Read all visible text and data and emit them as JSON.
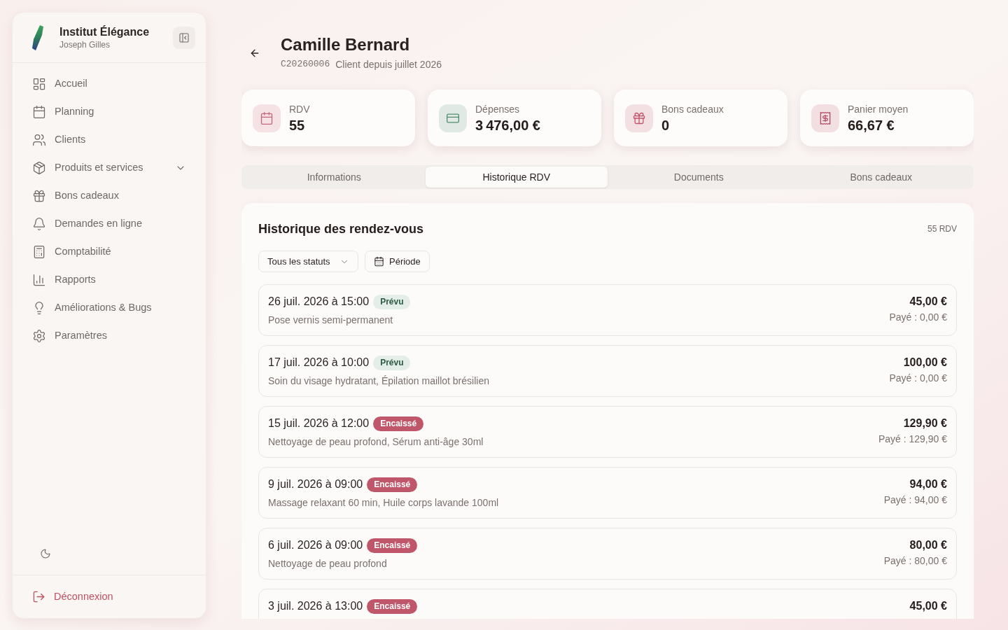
{
  "sidebar": {
    "brand": {
      "name": "Institut Élégance",
      "user": "Joseph Gilles"
    },
    "items": [
      {
        "label": "Accueil",
        "kind": "link",
        "selected": false
      },
      {
        "label": "Planning",
        "kind": "link",
        "selected": false
      },
      {
        "label": "Clients",
        "kind": "link",
        "selected": false
      },
      {
        "label": "Produits et services",
        "kind": "group",
        "selected": false,
        "expanded": false
      },
      {
        "label": "Bons cadeaux",
        "kind": "link",
        "selected": false
      },
      {
        "label": "Demandes en ligne",
        "kind": "link",
        "selected": false
      },
      {
        "label": "Comptabilité",
        "kind": "link",
        "selected": false
      },
      {
        "label": "Rapports",
        "kind": "link",
        "selected": false
      },
      {
        "label": "Améliorations & Bugs",
        "kind": "link",
        "selected": false
      },
      {
        "label": "Paramètres",
        "kind": "link",
        "selected": false
      }
    ],
    "logout": "Déconnexion"
  },
  "client": {
    "name": "Camille Bernard",
    "code": "C20260006",
    "since": "Client depuis juillet 2026"
  },
  "stats": [
    {
      "label": "RDV",
      "value": "55",
      "color": "#c4677a"
    },
    {
      "label": "Dépenses",
      "value": "3 476,00 €",
      "color": "#4f8f6e"
    },
    {
      "label": "Bons cadeaux",
      "value": "0",
      "color": "#c0566a"
    },
    {
      "label": "Panier moyen",
      "value": "66,67 €",
      "color": "#b5526a"
    }
  ],
  "tabs": [
    {
      "label": "Informations",
      "selected": false
    },
    {
      "label": "Historique RDV",
      "selected": true
    },
    {
      "label": "Documents",
      "selected": false
    },
    {
      "label": "Bons cadeaux",
      "selected": false
    }
  ],
  "history": {
    "title": "Historique des rendez-vous",
    "count": "55 RDV",
    "status_filter": {
      "value": "Tous les statuts"
    },
    "period_button": "Période",
    "appointments": [
      {
        "datetime": "26 juil. 2026 à 15:00",
        "status": {
          "label": "Prévu",
          "kind": "planned"
        },
        "services": "Pose vernis semi-permanent",
        "amount": "45,00 €",
        "paid": "Payé : 0,00 €"
      },
      {
        "datetime": "17 juil. 2026 à 10:00",
        "status": {
          "label": "Prévu",
          "kind": "planned"
        },
        "services": "Soin du visage hydratant, Épilation maillot brésilien",
        "amount": "100,00 €",
        "paid": "Payé : 0,00 €"
      },
      {
        "datetime": "15 juil. 2026 à 12:00",
        "status": {
          "label": "Encaissé",
          "kind": "cashed"
        },
        "services": "Nettoyage de peau profond, Sérum anti-âge 30ml",
        "amount": "129,90 €",
        "paid": "Payé : 129,90 €"
      },
      {
        "datetime": "9 juil. 2026 à 09:00",
        "status": {
          "label": "Encaissé",
          "kind": "cashed"
        },
        "services": "Massage relaxant 60 min, Huile corps lavande 100ml",
        "amount": "94,00 €",
        "paid": "Payé : 94,00 €"
      },
      {
        "datetime": "6 juil. 2026 à 09:00",
        "status": {
          "label": "Encaissé",
          "kind": "cashed"
        },
        "services": "Nettoyage de peau profond",
        "amount": "80,00 €",
        "paid": "Payé : 80,00 €"
      },
      {
        "datetime": "3 juil. 2026 à 13:00",
        "status": {
          "label": "Encaissé",
          "kind": "cashed"
        },
        "amount": "45,00 €"
      }
    ]
  }
}
